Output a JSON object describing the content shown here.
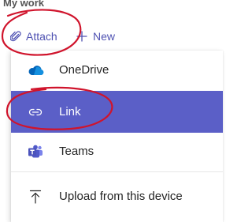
{
  "header": {
    "title": "My work"
  },
  "toolbar": {
    "attach_label": "Attach",
    "new_label": "New"
  },
  "menu": {
    "items": [
      {
        "label": "OneDrive",
        "icon": "onedrive-cloud-icon"
      },
      {
        "label": "Link",
        "icon": "link-icon",
        "selected": true
      },
      {
        "label": "Teams",
        "icon": "teams-icon"
      },
      {
        "label": "Upload from this device",
        "icon": "upload-icon"
      }
    ]
  },
  "colors": {
    "accent": "#4f52b2",
    "selected_bg": "#5b5fc7",
    "annotation_red": "#d0142c",
    "onedrive_blue": "#0364b8",
    "teams_purple": "#4b53bc"
  }
}
